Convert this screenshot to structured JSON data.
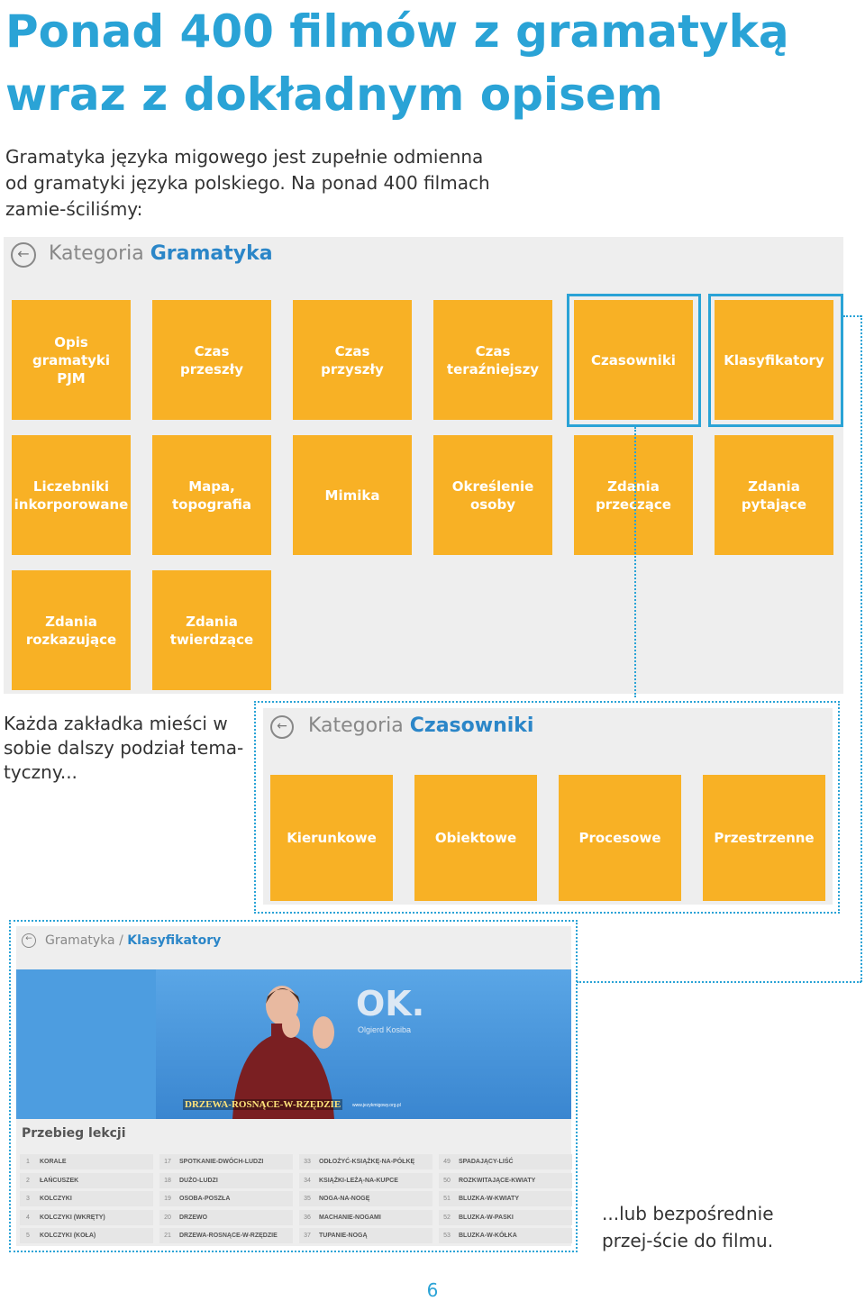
{
  "headline": "Ponad 400 filmów z gramatyką wraz z dokładnym opisem",
  "intro": "Gramatyka języka migowego jest zupełnie odmienna od gramatyki języka polskiego. Na ponad 400 filmach zamie-ściliśmy:",
  "grammar_screen": {
    "title_prefix": "Kategoria ",
    "title_bold": "Gramatyka",
    "back_icon": "arrow-left-circle-icon",
    "tiles": [
      "Opis\ngramatyki\nPJM",
      "Czas\nprzeszły",
      "Czas\nprzyszły",
      "Czas\nteraźniejszy",
      "Czasowniki",
      "Klasyfikatory",
      "Liczebniki\ninkorporowane",
      "Mapa,\ntopografia",
      "Mimika",
      "Określenie\nosoby",
      "Zdania\nprzeczące",
      "Zdania\npytające",
      "Zdania\nrozkazujące",
      "Zdania\ntwierdzące"
    ]
  },
  "note_left": "Każda zakładka mieści w sobie dalszy podział tema-tyczny...",
  "verbs_screen": {
    "title_prefix": "Kategoria ",
    "title_bold": "Czasowniki",
    "tiles": [
      "Kierunkowe",
      "Obiektowe",
      "Procesowe",
      "Przestrzenne"
    ]
  },
  "classifier_screen": {
    "breadcrumb_prefix": "Gramatyka / ",
    "breadcrumb_bold": "Klasyfikatory",
    "logo_text": "OK.",
    "logo_name": "Olgierd Kosiba",
    "caption": "DRZEWA-ROSNĄCE-W-RZĘDZIE",
    "site": "www.jezykmigowy.org.pl",
    "lesson_heading": "Przebieg lekcji",
    "lesson_items": [
      [
        "1",
        "KORALE"
      ],
      [
        "2",
        "ŁAŃCUSZEK"
      ],
      [
        "3",
        "KOLCZYKI"
      ],
      [
        "4",
        "KOLCZYKI (WKRĘTY)"
      ],
      [
        "5",
        "KOLCZYKI (KOŁA)"
      ],
      [
        "17",
        "SPOTKANIE-DWÓCH-LUDZI"
      ],
      [
        "18",
        "DUŻO-LUDZI"
      ],
      [
        "19",
        "OSOBA-POSZŁA"
      ],
      [
        "20",
        "DRZEWO"
      ],
      [
        "21",
        "DRZEWA-ROSNĄCE-W-RZĘDZIE"
      ],
      [
        "33",
        "ODŁOŻYĆ-KSIĄŻKĘ-NA-PÓŁKĘ"
      ],
      [
        "34",
        "KSIĄŻKI-LEŻĄ-NA-KUPCE"
      ],
      [
        "35",
        "NOGA-NA-NOGĘ"
      ],
      [
        "36",
        "MACHANIE-NOGAMI"
      ],
      [
        "37",
        "TUPANIE-NOGĄ"
      ],
      [
        "49",
        "SPADAJĄCY-LIŚĆ"
      ],
      [
        "50",
        "ROZKWITAJĄCE-KWIATY"
      ],
      [
        "51",
        "BLUZKA-W-KWIATY"
      ],
      [
        "52",
        "BLUZKA-W-PASKI"
      ],
      [
        "53",
        "BLUZKA-W-KÓŁKA"
      ]
    ]
  },
  "note_right": "...lub bezpośrednie przej-ście do filmu.",
  "page_number": "6",
  "colors": {
    "accent": "#2aa3d6",
    "tile": "#f8b125",
    "link": "#2b86c8"
  }
}
